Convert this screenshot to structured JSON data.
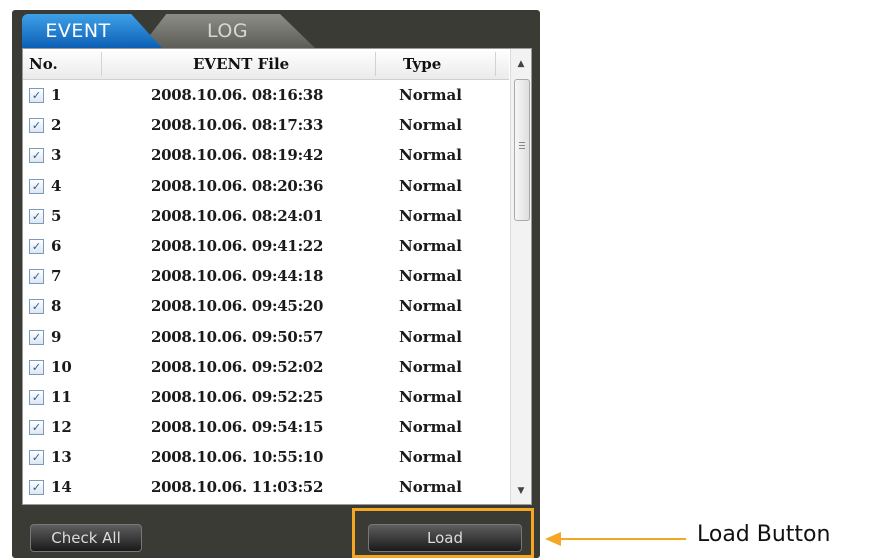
{
  "tabs": [
    {
      "label": "EVENT",
      "active": true
    },
    {
      "label": "LOG",
      "active": false
    }
  ],
  "table": {
    "columns": [
      "No.",
      "EVENT File",
      "Type"
    ],
    "rows": [
      {
        "no": "1",
        "file": "2008.10.06. 08:16:38",
        "type": "Normal",
        "checked": true
      },
      {
        "no": "2",
        "file": "2008.10.06. 08:17:33",
        "type": "Normal",
        "checked": true
      },
      {
        "no": "3",
        "file": "2008.10.06. 08:19:42",
        "type": "Normal",
        "checked": true
      },
      {
        "no": "4",
        "file": "2008.10.06. 08:20:36",
        "type": "Normal",
        "checked": true
      },
      {
        "no": "5",
        "file": "2008.10.06. 08:24:01",
        "type": "Normal",
        "checked": true
      },
      {
        "no": "6",
        "file": "2008.10.06. 09:41:22",
        "type": "Normal",
        "checked": true
      },
      {
        "no": "7",
        "file": "2008.10.06. 09:44:18",
        "type": "Normal",
        "checked": true
      },
      {
        "no": "8",
        "file": "2008.10.06. 09:45:20",
        "type": "Normal",
        "checked": true
      },
      {
        "no": "9",
        "file": "2008.10.06. 09:50:57",
        "type": "Normal",
        "checked": true
      },
      {
        "no": "10",
        "file": "2008.10.06. 09:52:02",
        "type": "Normal",
        "checked": true
      },
      {
        "no": "11",
        "file": "2008.10.06. 09:52:25",
        "type": "Normal",
        "checked": true
      },
      {
        "no": "12",
        "file": "2008.10.06. 09:54:15",
        "type": "Normal",
        "checked": true
      },
      {
        "no": "13",
        "file": "2008.10.06. 10:55:10",
        "type": "Normal",
        "checked": true
      },
      {
        "no": "14",
        "file": "2008.10.06. 11:03:52",
        "type": "Normal",
        "checked": true
      }
    ]
  },
  "buttons": {
    "check_all": "Check All",
    "load": "Load"
  },
  "callout": {
    "label": "Load Button"
  },
  "colors": {
    "panel": "#3b3b36",
    "active_tab": "#1a74cc",
    "highlight": "#f5a623"
  },
  "icons": {
    "checkbox": "check-mark",
    "scroll_up": "chevron-up-icon",
    "scroll_down": "chevron-down-icon"
  }
}
